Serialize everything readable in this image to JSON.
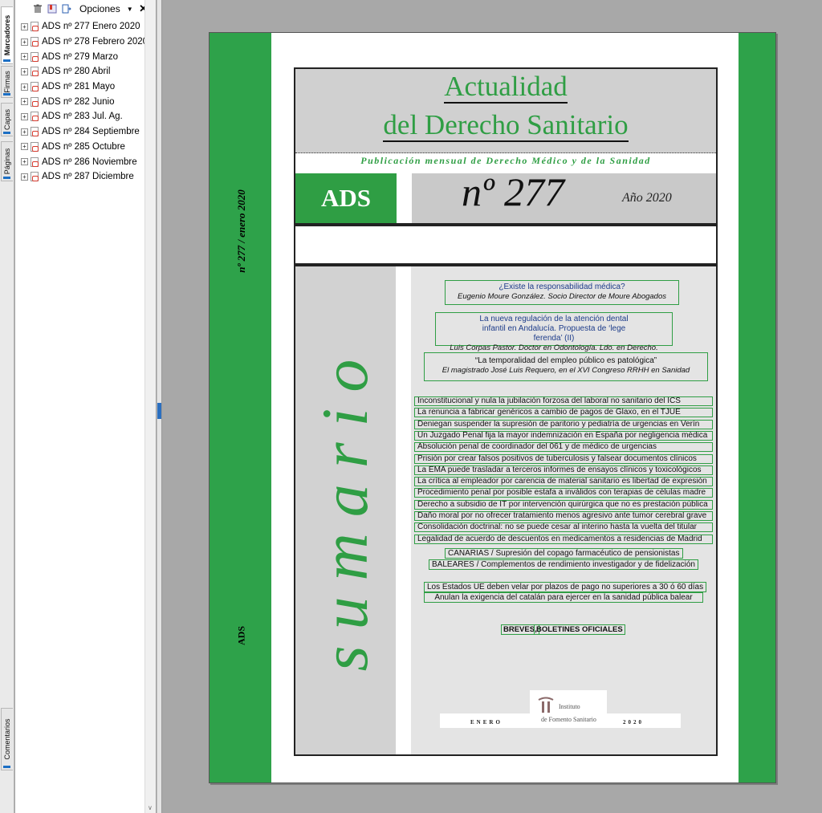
{
  "side_tabs": [
    "Marcadores",
    "Firmas",
    "Capas",
    "Páginas",
    "Comentarios"
  ],
  "toolbar": {
    "options_label": "Opciones",
    "close_glyph": "✕"
  },
  "bookmarks": [
    "ADS nº 277 Enero 2020",
    "ADS nº 278 Febrero 2020",
    "ADS nº 279 Marzo",
    "ADS nº 280 Abril",
    "ADS nº 281 Mayo",
    "ADS nº 282 Junio",
    "ADS nº 283 Jul. Ag.",
    "ADS nº 284 Septiembre",
    "ADS nº 285 Octubre",
    "ADS nº 286 Noviembre",
    "ADS nº 287 Diciembre"
  ],
  "cover": {
    "title_line1": "Actualidad",
    "title_line2": "del Derecho Sanitario",
    "subtitle": "Publicación mensual de Derecho Médico y de la Sanidad",
    "ads": "ADS",
    "number": "nº 277",
    "year": "Año 2020",
    "vertical_issue": "nº 277 / enero 2020",
    "vertical_ads": "ADS",
    "sumario": "sumario",
    "features": [
      {
        "title": "¿Existe la responsabilidad médica?",
        "author": "Eugenio Moure González. Socio Director de Moure Abogados"
      },
      {
        "title": "La nueva regulación de la atención dental infantil en Andalucía. Propuesta de ‘lege ferenda’ (II)",
        "author": "Luis Corpas Pastor. Doctor en Odontología. Ldo. en Derecho."
      },
      {
        "title": "“La temporalidad del empleo público es patológica”",
        "author": "El magistrado José Luis Requero, en el XVI Congreso RRHH en Sanidad"
      }
    ],
    "headlines": [
      "Inconstitucional y nula la jubilación forzosa del laboral no sanitario del ICS",
      "La renuncia a fabricar genéricos a cambio de pagos de Glaxo, en el TJUE",
      "Deniegan suspender la supresión de paritorio y pediatría de urgencias en Verín",
      "Un Juzgado Penal fija la mayor indemnización en España por negligencia médica",
      "Absolución penal de coordinador del 061 y de médico de urgencias",
      "Prisión por crear falsos positivos de tuberculosis y falsear documentos clínicos",
      "La EMA puede trasladar a terceros informes de ensayos clínicos y toxicológicos",
      "La crítica al empleador por carencia de material sanitario es libertad de expresión",
      "Procedimiento penal por posible estafa a inválidos con terapias de células madre",
      "Derecho a subsidio de IT por intervención quirúrgica que no es prestación pública",
      "Daño moral por no ofrecer tratamiento menos agresivo ante tumor cerebral grave",
      "Consolidación doctrinal: no se puede cesar al interino hasta la vuelta del titular",
      "Legalidad de acuerdo de descuentos en medicamentos a residencias de Madrid"
    ],
    "regional": [
      "CANARIAS / Supresión del copago farmacéutico de pensionistas",
      "BALEARES / Complementos de rendimiento investigador y de fidelización"
    ],
    "eu_news": [
      "Los Estados UE deben velar por plazos de pago no superiores a 30 ó 60 días",
      "Anulan la exigencia del catalán para ejercer en la sanidad pública balear"
    ],
    "sections": [
      "BREVES,",
      "BOLETINES OFICIALES"
    ],
    "footer_month": "ENERO",
    "footer_year": "2020",
    "logo_line1": "Instituto",
    "logo_line2": "de Fomento Sanitario"
  },
  "colors": {
    "green": "#2f9e44",
    "gray": "#d0d0d0",
    "navy": "#1d3c8a"
  }
}
